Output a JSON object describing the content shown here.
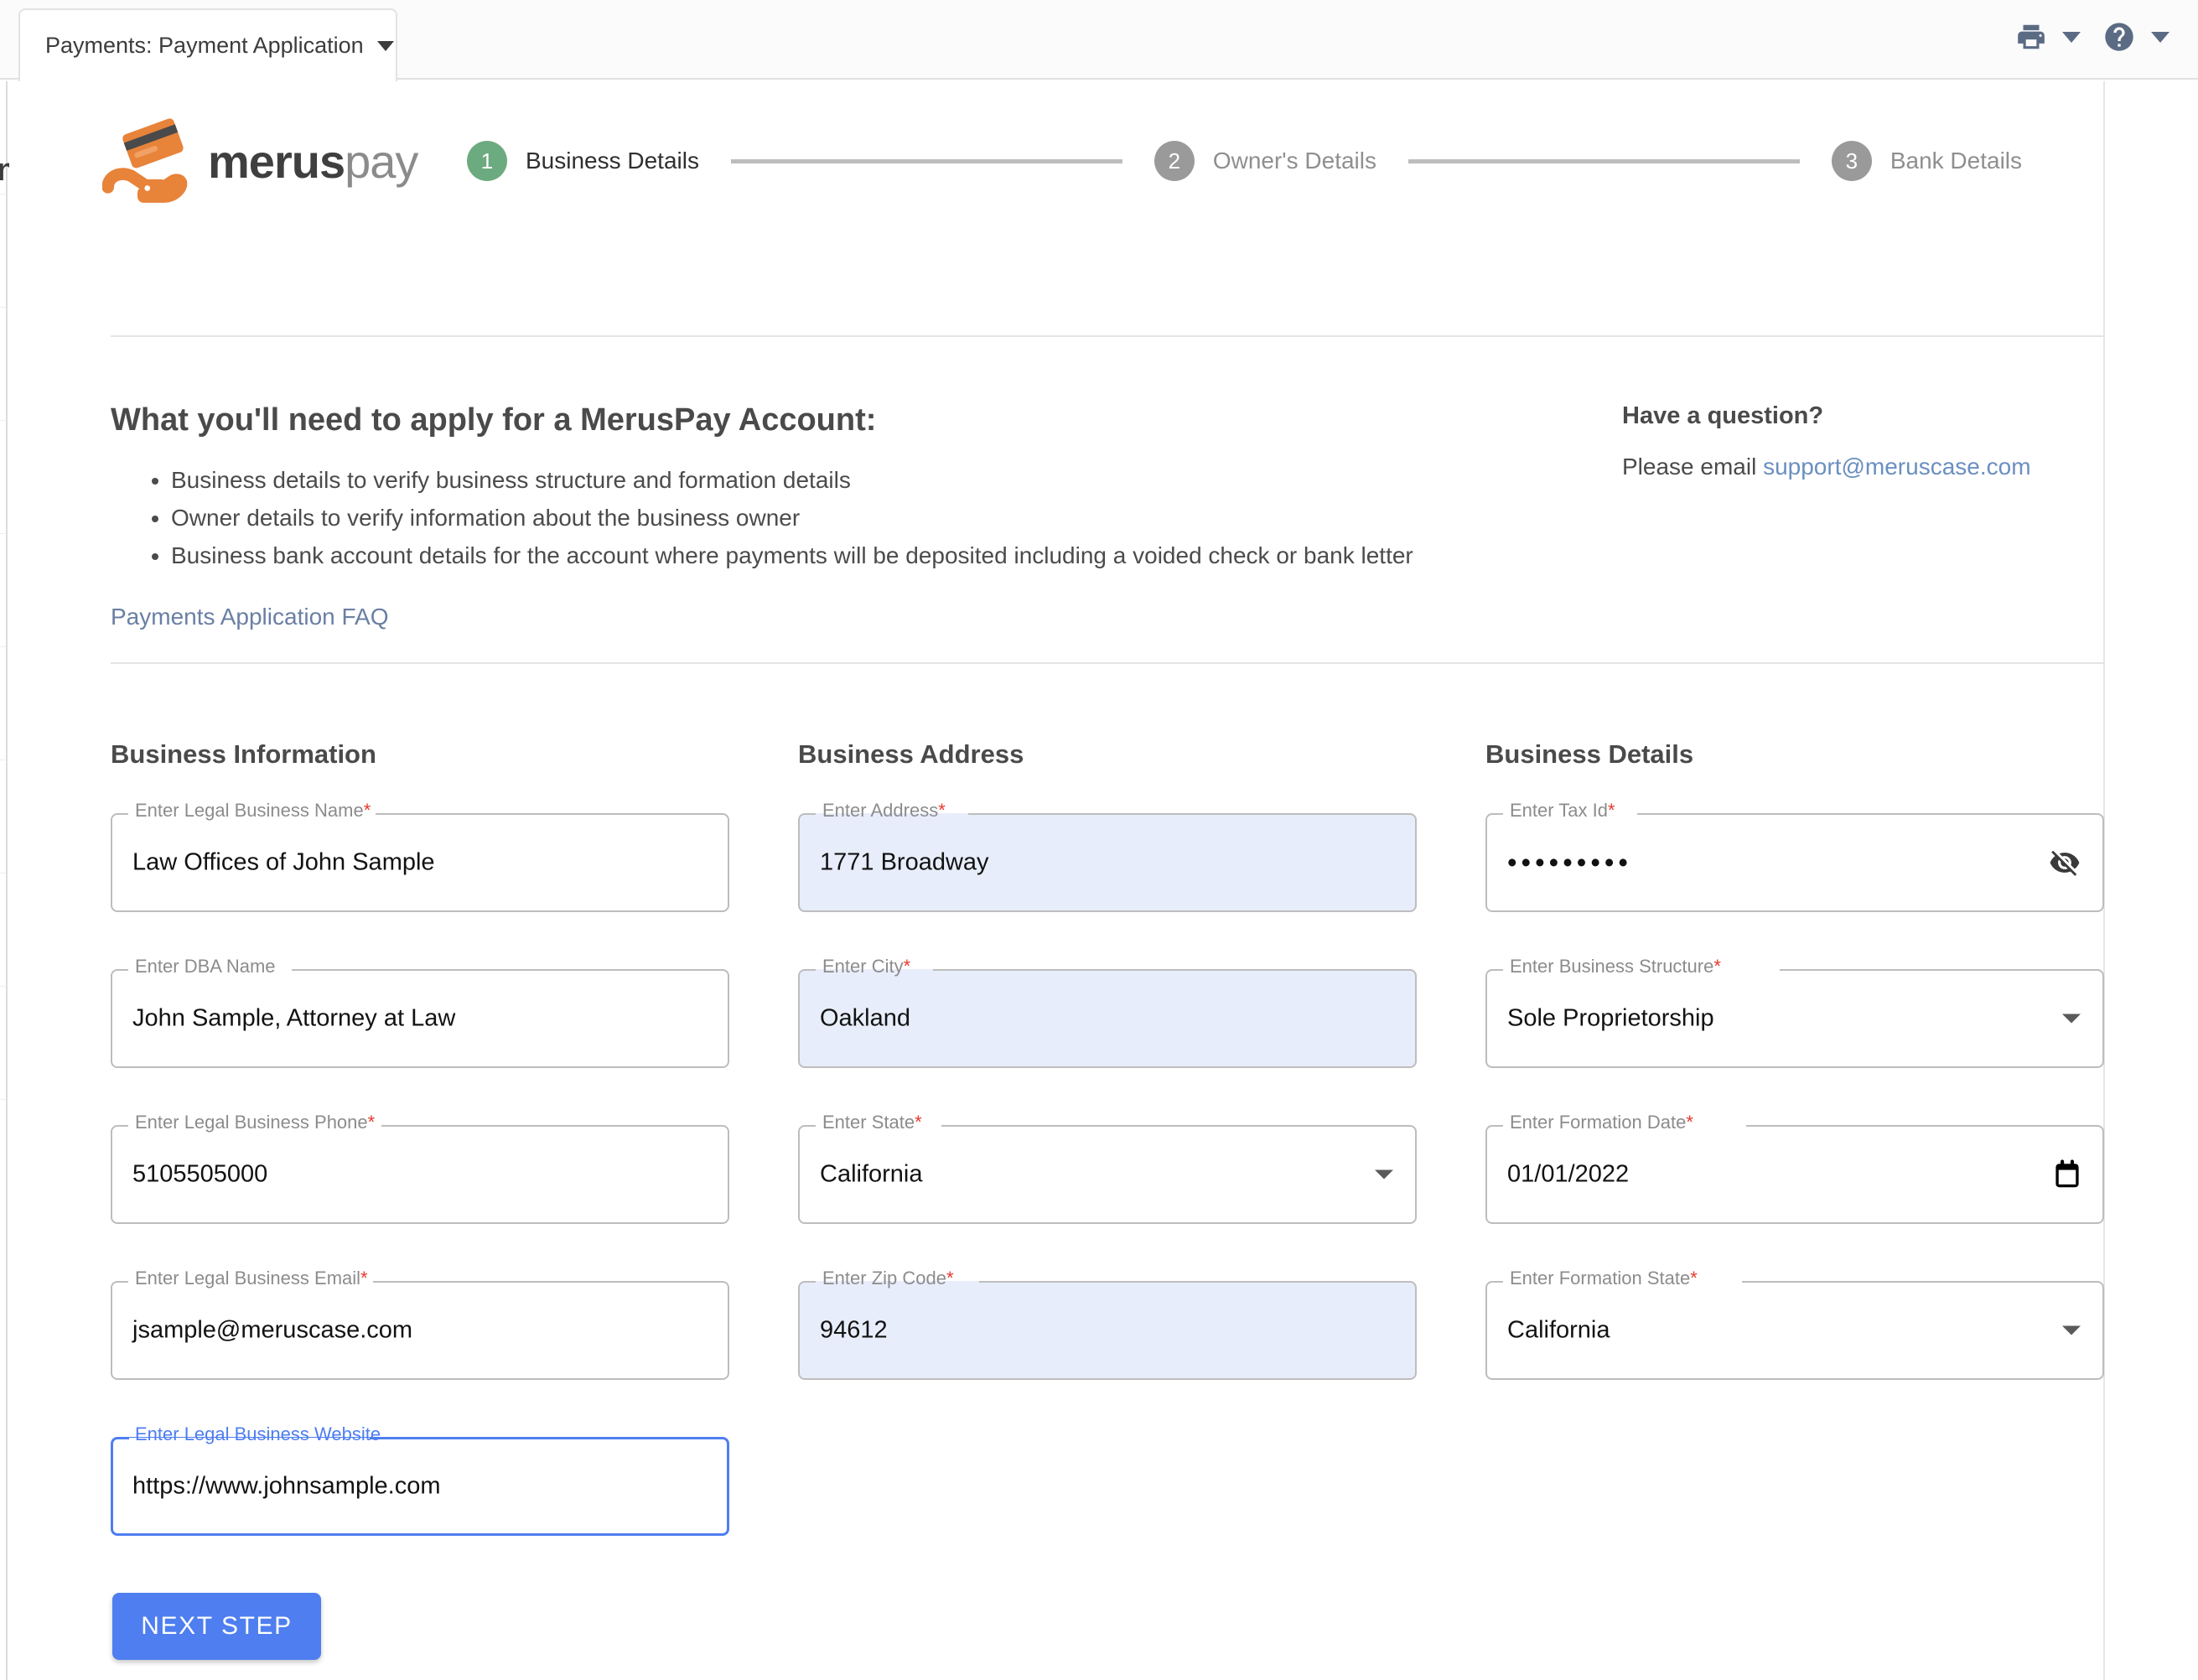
{
  "window": {
    "tab_label": "Payments: Payment Application",
    "tab_caret_icon": "chevron-down-icon",
    "print_icon": "printer-icon",
    "print_caret_icon": "chevron-down-icon",
    "help_icon": "question-circle-icon",
    "help_caret_icon": "chevron-down-icon"
  },
  "sidebar": {
    "partial_glyph": "n"
  },
  "brand": {
    "name_bold": "merus",
    "name_light": "pay",
    "logo_icon": "hand-holding-card-icon",
    "colors": {
      "orange": "#e8833a",
      "dark": "#4a4a4a"
    }
  },
  "stepper": {
    "active_color": "#6cab7f",
    "idle_color": "#9a9a9a",
    "steps": [
      {
        "number": "1",
        "label": "Business Details",
        "state": "active"
      },
      {
        "number": "2",
        "label": "Owner's Details",
        "state": "idle"
      },
      {
        "number": "3",
        "label": "Bank Details",
        "state": "idle"
      }
    ]
  },
  "intro": {
    "heading": "What you'll need to apply for a MerusPay Account:",
    "bullets": [
      "Business details to verify business structure and formation details",
      "Owner details to verify information about the business owner",
      "Business bank account details for the account where payments will be deposited including a voided check or bank letter"
    ],
    "faq_link": "Payments Application FAQ"
  },
  "help": {
    "heading": "Have a question?",
    "prefix": "Please email ",
    "email": "support@meruscase.com"
  },
  "form": {
    "columns": [
      {
        "title": "Business Information",
        "fields": [
          {
            "label": "Enter Legal Business Name",
            "required": true,
            "value": "Law Offices of John Sample",
            "type": "text",
            "autofilled": false,
            "focused": false
          },
          {
            "label": "Enter DBA Name",
            "required": false,
            "value": "John Sample, Attorney at Law",
            "type": "text",
            "autofilled": false,
            "focused": false
          },
          {
            "label": "Enter Legal Business Phone",
            "required": true,
            "value": "5105505000",
            "type": "text",
            "autofilled": false,
            "focused": false
          },
          {
            "label": "Enter Legal Business Email",
            "required": true,
            "value": "jsample@meruscase.com",
            "type": "text",
            "autofilled": false,
            "focused": false
          },
          {
            "label": "Enter Legal Business Website",
            "required": false,
            "value": "https://www.johnsample.com",
            "type": "text",
            "autofilled": false,
            "focused": true
          }
        ]
      },
      {
        "title": "Business Address",
        "fields": [
          {
            "label": "Enter Address",
            "required": true,
            "value": "1771 Broadway",
            "type": "text",
            "autofilled": true,
            "focused": false
          },
          {
            "label": "Enter City",
            "required": true,
            "value": "Oakland",
            "type": "text",
            "autofilled": true,
            "focused": false
          },
          {
            "label": "Enter State",
            "required": true,
            "value": "California",
            "type": "select",
            "autofilled": false,
            "focused": false
          },
          {
            "label": "Enter Zip Code",
            "required": true,
            "value": "94612",
            "type": "text",
            "autofilled": true,
            "focused": false
          }
        ]
      },
      {
        "title": "Business Details",
        "fields": [
          {
            "label": "Enter Tax Id",
            "required": true,
            "value": "•••••••••",
            "type": "password",
            "autofilled": false,
            "focused": false,
            "adorn_icon": "visibility-off-icon"
          },
          {
            "label": "Enter Business Structure",
            "required": true,
            "value": "Sole Proprietorship",
            "type": "select",
            "autofilled": false,
            "focused": false
          },
          {
            "label": "Enter Formation Date",
            "required": true,
            "value": "01/01/2022",
            "type": "date",
            "autofilled": false,
            "focused": false,
            "adorn_icon": "calendar-icon"
          },
          {
            "label": "Enter Formation State",
            "required": true,
            "value": "California",
            "type": "select",
            "autofilled": false,
            "focused": false
          }
        ]
      }
    ]
  },
  "actions": {
    "next_step_label": "NEXT STEP",
    "next_step_color": "#4e7ef0"
  }
}
